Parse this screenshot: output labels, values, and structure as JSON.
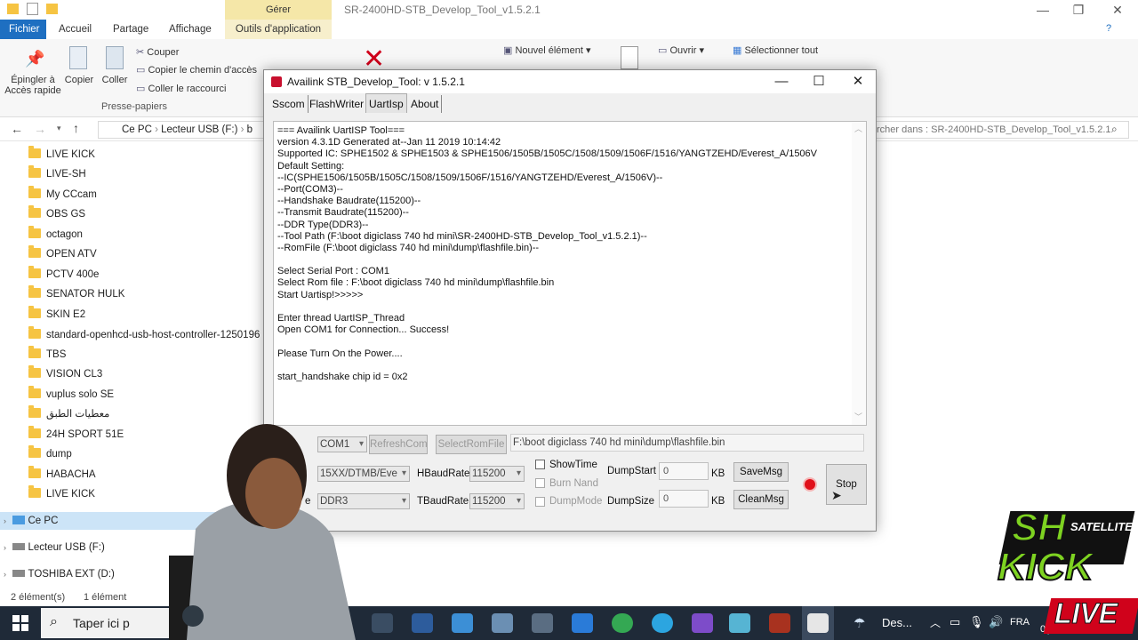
{
  "explorer": {
    "context_group": "Gérer",
    "window_title": "SR-2400HD-STB_Develop_Tool_v1.5.2.1",
    "tabs": [
      "Fichier",
      "Accueil",
      "Partage",
      "Affichage",
      "Outils d'application"
    ],
    "ribbon": {
      "pin_label_1": "Épingler à",
      "pin_label_2": "Accès rapide",
      "copy": "Copier",
      "paste": "Coller",
      "cut": "Couper",
      "copy_path": "Copier le chemin d'accès",
      "paste_shortcut": "Coller le raccourci",
      "clipboard_group": "Presse-papiers",
      "new_item": "Nouvel élément",
      "open": "Ouvrir",
      "select_all": "Sélectionner tout"
    },
    "breadcrumb": [
      "Ce PC",
      "Lecteur USB (F:)",
      "b"
    ],
    "search_placeholder": "rcher dans : SR-2400HD-STB_Develop_Tool_v1.5.2.1",
    "folders": [
      "LIVE KICK",
      "LIVE-SH",
      "My CCcam",
      "OBS GS",
      "octagon",
      "OPEN ATV",
      "PCTV 400e",
      "SENATOR HULK",
      "SKIN E2",
      "standard-openhcd-usb-host-controller-1250196",
      "TBS",
      "VISION CL3",
      "vuplus solo SE",
      "معطيات الطبق",
      "24H SPORT 51E",
      "dump",
      "HABACHA",
      "LIVE KICK"
    ],
    "drives": [
      "Ce PC",
      "Lecteur USB (F:)",
      "TOSHIBA EXT (D:)"
    ],
    "status_left": "2 élément(s)",
    "status_right": "1 élément"
  },
  "taskbar": {
    "search_placeholder": "Taper ici p",
    "weather": "Des...",
    "lang": "FRA",
    "clock_partial": "0("
  },
  "dialog": {
    "title": "Availink STB_Develop_Tool: v 1.5.2.1",
    "tabs": [
      "Sscom",
      "FlashWriter",
      "UartIsp",
      "About"
    ],
    "active_tab": "UartIsp",
    "log_lines": [
      "=== Availink UartISP Tool===",
      "version 4.3.1D Generated at--Jan 11 2019 10:14:42",
      "Supported IC: SPHE1502 & SPHE1503 & SPHE1506/1505B/1505C/1508/1509/1506F/1516/YANGTZEHD/Everest_A/1506V",
      "Default Setting:",
      "--IC(SPHE1506/1505B/1505C/1508/1509/1506F/1516/YANGTZEHD/Everest_A/1506V)--",
      "--Port(COM3)--",
      "--Handshake Baudrate(115200)--",
      "--Transmit Baudrate(115200)--",
      "--DDR Type(DDR3)--",
      "--Tool Path (F:\\boot digiclass 740 hd mini\\SR-2400HD-STB_Develop_Tool_v1.5.2.1)--",
      "--RomFile (F:\\boot digiclass 740 hd mini\\dump\\flashfile.bin)--",
      "",
      "Select Serial Port : COM1",
      "Select Rom file : F:\\boot digiclass 740 hd mini\\dump\\flashfile.bin",
      "Start Uartisp!>>>>>",
      "",
      "Enter thread UartISP_Thread",
      "Open COM1 for Connection... Success!",
      "",
      "Please Turn On the Power....",
      "",
      "start_handshake chip id = 0x2"
    ],
    "port_value": "COM1",
    "refresh_com": "RefreshCom",
    "select_rom": "SelectRomFile",
    "rom_path": "F:\\boot digiclass 740 hd mini\\dump\\flashfile.bin",
    "ic_value": "15XX/DTMB/Eve",
    "ddr_partial_label": "e",
    "ddr_value": "DDR3",
    "hbaud_label": "HBaudRate",
    "hbaud_value": "115200",
    "tbaud_label": "TBaudRate",
    "tbaud_value": "115200",
    "show_time": "ShowTime",
    "burn_nand": "Burn Nand",
    "dump_mode": "DumpMode",
    "dump_start_label": "DumpStart",
    "dump_start_value": "0",
    "dump_size_label": "DumpSize",
    "dump_size_value": "0",
    "kb": "KB",
    "save_msg": "SaveMsg",
    "clean_msg": "CleanMsg",
    "stop": "Stop",
    "status_color": "#e0101a"
  },
  "logo": {
    "line1": "SH",
    "line2": "SATELLITE",
    "line3": "KICK",
    "line4": "LIVE",
    "brand_color": "#7ed321"
  }
}
